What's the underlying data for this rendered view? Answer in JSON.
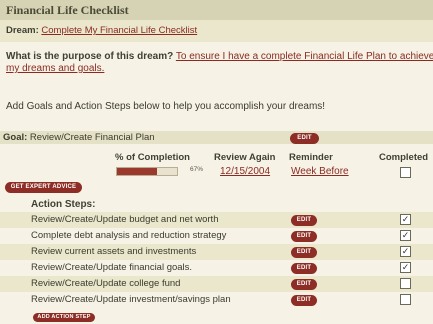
{
  "title": "Financial Life Checklist",
  "dream": {
    "label": "Dream:",
    "value": "Complete My Financial Life Checklist"
  },
  "purpose": {
    "question": "What is the purpose of this dream?",
    "answer_line1": "To ensure I have a complete Financial Life Plan to achieve",
    "answer_line2": "my dreams and goals."
  },
  "intro_text": "Add Goals and Action Steps below to help you accomplish your dreams!",
  "goal": {
    "label": "Goal:",
    "name": "Review/Create Financial Plan",
    "edit_label": "EDIT"
  },
  "columns": {
    "completion": "% of Completion",
    "review": "Review Again",
    "reminder": "Reminder",
    "completed": "Completed"
  },
  "progress": {
    "percent": 67,
    "percent_text": "67%"
  },
  "review_date": "12/15/2004",
  "reminder_value": "Week Before",
  "goal_completed": false,
  "expert_button": "GET EXPERT ADVICE",
  "action_steps_label": "Action Steps:",
  "steps": [
    {
      "text": "Review/Create/Update budget and net worth",
      "edit": "EDIT",
      "checked": true
    },
    {
      "text": "Complete debt analysis and reduction strategy",
      "edit": "EDIT",
      "checked": true
    },
    {
      "text": "Review current assets and investments",
      "edit": "EDIT",
      "checked": true
    },
    {
      "text": "Review/Create/Update financial goals.",
      "edit": "EDIT",
      "checked": true
    },
    {
      "text": "Review/Create/Update college fund",
      "edit": "EDIT",
      "checked": false
    },
    {
      "text": "Review/Create/Update investment/savings plan",
      "edit": "EDIT",
      "checked": false
    }
  ],
  "add_action_button": "ADD ACTION STEP",
  "colors": {
    "accent": "#8d2d25",
    "link": "#8a2a22",
    "progress_fill": "#9b3a2c"
  }
}
